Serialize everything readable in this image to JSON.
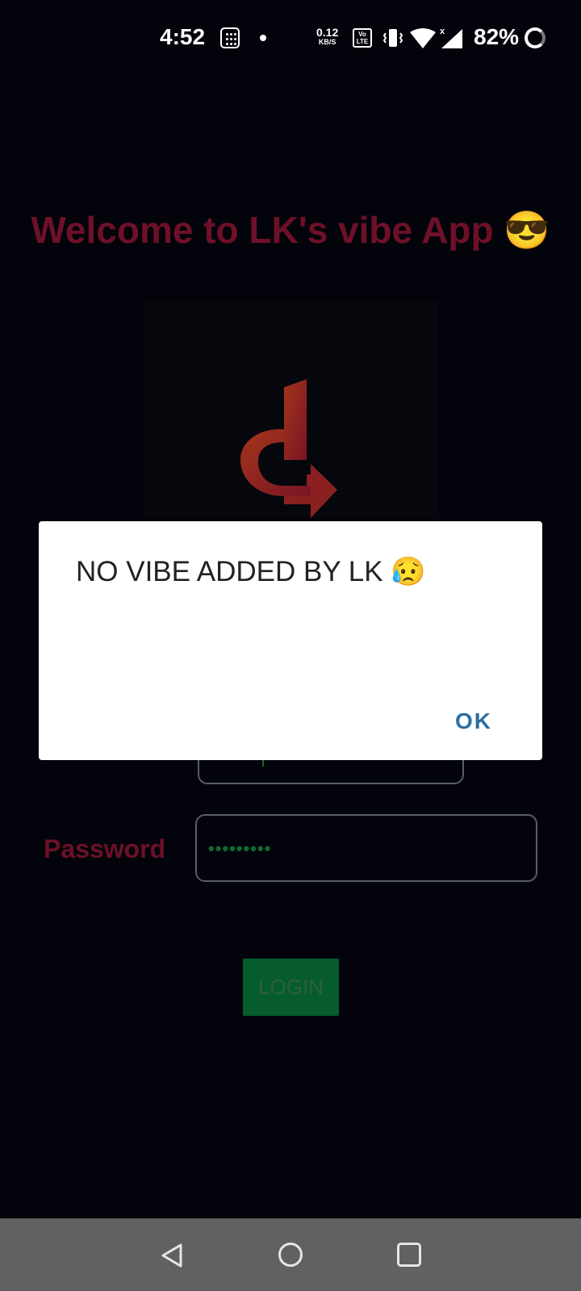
{
  "status_bar": {
    "time": "4:52",
    "net_speed_value": "0.12",
    "net_speed_unit": "KB/S",
    "volte_top": "Vo",
    "volte_bottom": "LTE",
    "battery": "82%",
    "icons": [
      "calculator-icon",
      "notification-dot-icon",
      "volte-icon",
      "vibrate-icon",
      "wifi-icon",
      "signal-icon",
      "battery-ring-icon"
    ]
  },
  "screen": {
    "welcome": "Welcome to LK's vibe App 😎",
    "password_label": "Password",
    "password_value": "•••••••••",
    "login_label": "LOGIN"
  },
  "dialog": {
    "message": "NO VIBE ADDED BY LK 😥",
    "ok_label": "OK"
  },
  "nav_bar": {
    "icons": [
      "back-icon",
      "home-icon",
      "recents-icon"
    ]
  },
  "colors": {
    "background": "#03040b",
    "accent_red": "#6e1028",
    "login_green": "#075c2c",
    "dialog_ok": "#2b6ea3"
  }
}
